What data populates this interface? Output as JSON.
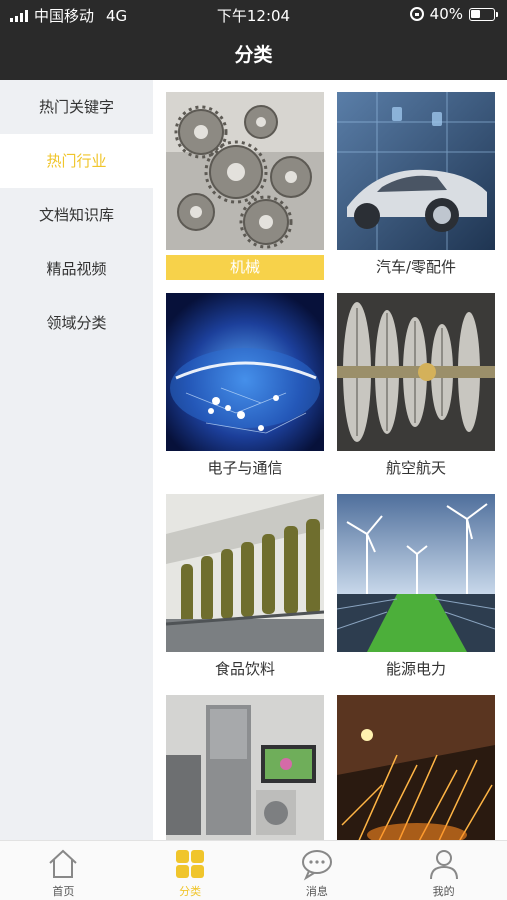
{
  "status_bar": {
    "carrier": "中国移动",
    "network": "4G",
    "time": "下午12:04",
    "battery_percent": "40%",
    "battery_level": 0.4
  },
  "header": {
    "title": "分类"
  },
  "sidebar": {
    "active_index": 1,
    "items": [
      {
        "label": "热门关键字"
      },
      {
        "label": "热门行业"
      },
      {
        "label": "文档知识库"
      },
      {
        "label": "精品视频"
      },
      {
        "label": "领域分类"
      }
    ]
  },
  "categories": {
    "selected_index": 0,
    "items": [
      {
        "label": "机械",
        "image": "gears"
      },
      {
        "label": "汽车/零配件",
        "image": "car"
      },
      {
        "label": "电子与通信",
        "image": "network-globe"
      },
      {
        "label": "航空航天",
        "image": "turbine"
      },
      {
        "label": "食品饮料",
        "image": "bottling-line"
      },
      {
        "label": "能源电力",
        "image": "solar-wind"
      },
      {
        "label": "",
        "image": "appliances"
      },
      {
        "label": "",
        "image": "sparks"
      }
    ]
  },
  "colors": {
    "header_bg": "#2a2a2a",
    "accent": "#f0c52b",
    "selected_label_bg": "#f7d24a",
    "sidebar_bg": "#eef0f3"
  },
  "tabbar": {
    "active_index": 1,
    "tabs": [
      {
        "label": "首页",
        "icon": "home-icon"
      },
      {
        "label": "分类",
        "icon": "grid-icon"
      },
      {
        "label": "消息",
        "icon": "message-icon"
      },
      {
        "label": "我的",
        "icon": "user-icon"
      }
    ]
  }
}
